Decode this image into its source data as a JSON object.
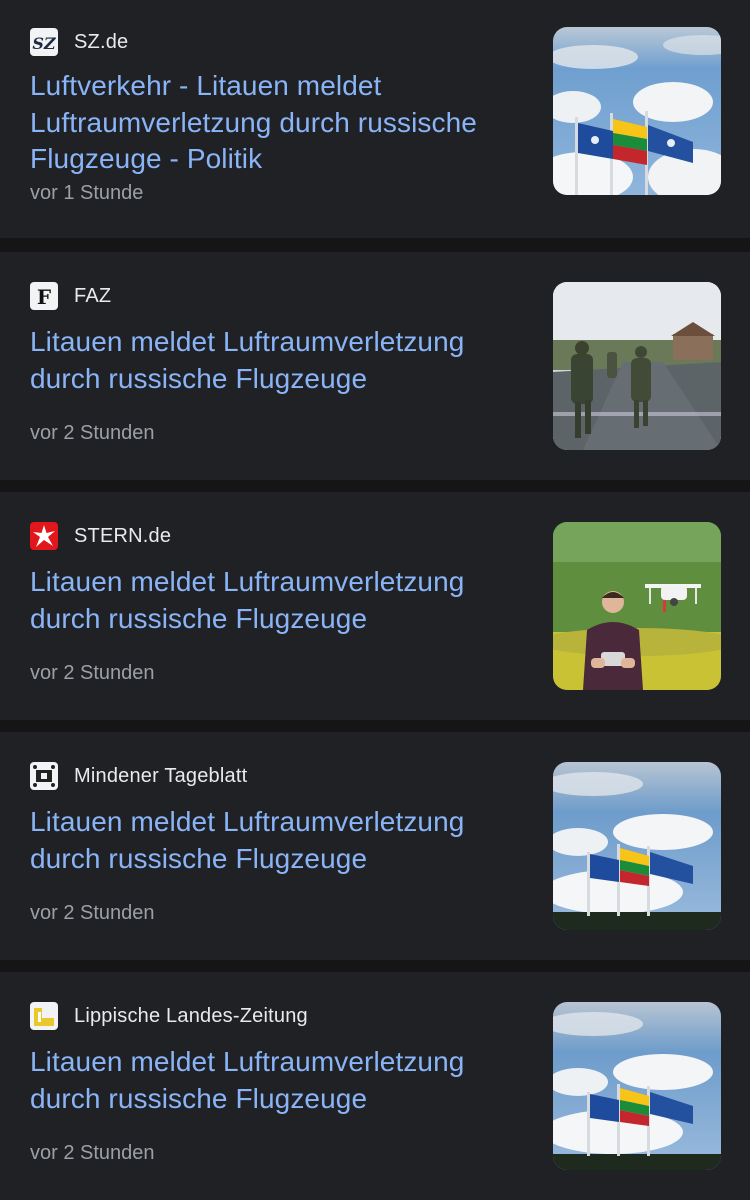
{
  "articles": [
    {
      "source": "SZ.de",
      "logo_icon": "sz-logo-icon",
      "title": "Luftverkehr - Litauen meldet Luftraumverletzung durch russische Flugzeuge - Politik",
      "time": "vor 1 Stunde",
      "thumbnail": "flags-image"
    },
    {
      "source": "FAZ",
      "logo_icon": "faz-logo-icon",
      "title": "Litauen meldet Luftraumverletzung durch russische Flugzeuge",
      "time": "vor 2 Stunden",
      "thumbnail": "soldiers-image"
    },
    {
      "source": "STERN.de",
      "logo_icon": "stern-logo-icon",
      "title": "Litauen meldet Luftraumverletzung durch russische Flugzeuge",
      "time": "vor 2 Stunden",
      "thumbnail": "drone-image"
    },
    {
      "source": "Mindener Tageblatt",
      "logo_icon": "mt-logo-icon",
      "title": "Litauen meldet Luftraumverletzung durch russische Flugzeuge",
      "time": "vor 2 Stunden",
      "thumbnail": "flags-image"
    },
    {
      "source": "Lippische Landes-Zeitung",
      "logo_icon": "lz-logo-icon",
      "title": "Litauen meldet Luftraumverletzung durch russische Flugzeuge",
      "time": "vor 2 Stunden",
      "thumbnail": "flags-image"
    }
  ],
  "colors": {
    "background": "#151515",
    "card": "#202124",
    "headline": "#8ab4f8",
    "source": "#e8eaed",
    "time": "#9aa0a6"
  }
}
